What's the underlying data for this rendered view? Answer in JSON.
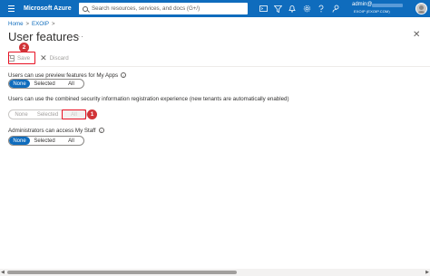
{
  "header": {
    "brand": "Microsoft Azure",
    "search_placeholder": "Search resources, services, and docs (G+/)",
    "icons": [
      "cloud-shell-icon",
      "directory-filter-icon",
      "bell-icon",
      "gear-icon",
      "help-icon",
      "feedback-icon"
    ],
    "account_name": "admin@",
    "account_tenant": "EXOIP (EXOIP.COM)"
  },
  "breadcrumb": {
    "home": "Home",
    "separator": ">",
    "current": "EXOIP",
    "separator2": ">"
  },
  "page": {
    "title": "User features",
    "more": "···",
    "close": "✕"
  },
  "toolbar": {
    "save_label": "Save",
    "discard_label": "Discard"
  },
  "annotations": {
    "badge_save": "2",
    "badge_all": "1",
    "color": "#d13438"
  },
  "settings": [
    {
      "label": "Users can use preview features for My Apps",
      "options": [
        "None",
        "Selected",
        "All"
      ],
      "selected": "None",
      "disabled": false
    },
    {
      "label": "Users can use the combined security information registration experience (new tenants are automatically enabled)",
      "options": [
        "None",
        "Selected",
        "All"
      ],
      "selected": "All",
      "disabled": true
    },
    {
      "label": "Administrators can access My Staff",
      "options": [
        "None",
        "Selected",
        "All"
      ],
      "selected": "None",
      "disabled": false
    }
  ],
  "colors": {
    "accent": "#0f6cbd",
    "highlight": "#e81123"
  }
}
